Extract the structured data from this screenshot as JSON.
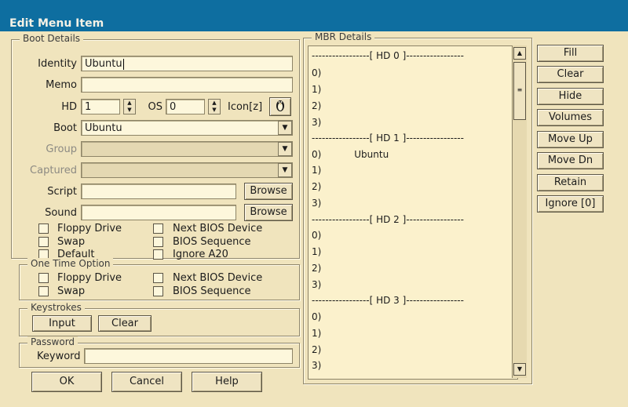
{
  "window": {
    "title": "Edit Menu Item"
  },
  "boot_details": {
    "title": "Boot Details",
    "identity": {
      "label": "Identity",
      "value": "Ubuntu"
    },
    "memo": {
      "label": "Memo",
      "value": ""
    },
    "hd": {
      "label": "HD",
      "value": "1"
    },
    "os": {
      "label": "OS",
      "value": "0"
    },
    "icon": {
      "label": "Icon[z]",
      "glyph": "tux-penguin-icon"
    },
    "boot": {
      "label": "Boot",
      "value": "Ubuntu"
    },
    "group": {
      "label": "Group",
      "value": ""
    },
    "captured": {
      "label": "Captured",
      "value": ""
    },
    "script": {
      "label": "Script",
      "value": "",
      "browse": "Browse"
    },
    "sound": {
      "label": "Sound",
      "value": "",
      "browse": "Browse"
    },
    "checkboxes": [
      "Floppy Drive",
      "Swap",
      "Default",
      "Next BIOS Device",
      "BIOS Sequence",
      "Ignore A20"
    ]
  },
  "one_time_option": {
    "title": "One Time Option",
    "checkboxes": [
      "Floppy Drive",
      "Swap",
      "Next BIOS Device",
      "BIOS Sequence"
    ]
  },
  "keystrokes": {
    "title": "Keystrokes",
    "input": "Input",
    "clear": "Clear"
  },
  "password": {
    "title": "Password",
    "keyword_label": "Keyword",
    "keyword_value": ""
  },
  "footer": {
    "ok": "OK",
    "cancel": "Cancel",
    "help": "Help"
  },
  "mbr_details": {
    "title": "MBR Details",
    "lines": [
      "-----------------[ HD 0 ]-----------------",
      "0)",
      "1)",
      "2)",
      "3)",
      "-----------------[ HD 1 ]-----------------",
      "0)           Ubuntu",
      "1)",
      "2)",
      "3)",
      "-----------------[ HD 2 ]-----------------",
      "0)",
      "1)",
      "2)",
      "3)",
      "-----------------[ HD 3 ]-----------------",
      "0)",
      "1)",
      "2)",
      "3)"
    ]
  },
  "side_buttons": [
    "Fill",
    "Clear",
    "Hide",
    "Volumes",
    "Move Up",
    "Move Dn",
    "Retain",
    "Ignore [0]"
  ],
  "colors": {
    "titlebar": "#0e6ea0",
    "dialog_bg": "#f0e4bd",
    "field_bg": "#fdf7dc"
  }
}
